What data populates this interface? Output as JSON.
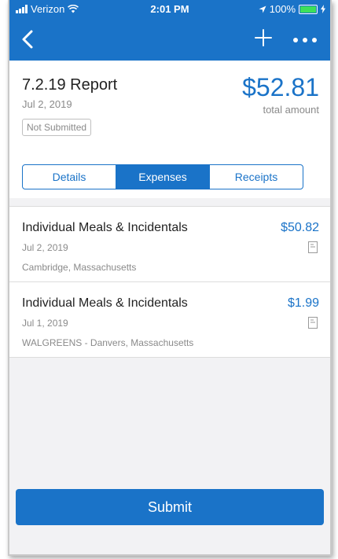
{
  "status_bar": {
    "carrier": "Verizon",
    "time": "2:01 PM",
    "battery": "100%"
  },
  "nav": {
    "back_icon": "chevron-left-icon",
    "add_icon": "plus-icon",
    "more_icon": "ellipsis-icon"
  },
  "report": {
    "title": "7.2.19 Report",
    "date": "Jul 2, 2019",
    "status": "Not Submitted",
    "total": "$52.81",
    "total_label": "total amount"
  },
  "tabs": [
    {
      "label": "Details",
      "active": false
    },
    {
      "label": "Expenses",
      "active": true
    },
    {
      "label": "Receipts",
      "active": false
    }
  ],
  "expenses": [
    {
      "name": "Individual Meals & Incidentals",
      "date": "Jul 2, 2019",
      "location": "Cambridge, Massachusetts",
      "amount": "$50.82",
      "icon": "receipt-icon"
    },
    {
      "name": "Individual Meals & Incidentals",
      "date": "Jul 1, 2019",
      "location": "WALGREENS - Danvers, Massachusetts",
      "amount": "$1.99",
      "icon": "receipt-icon"
    }
  ],
  "submit_label": "Submit",
  "colors": {
    "accent": "#1a73c8",
    "background": "#f2f2f4"
  }
}
